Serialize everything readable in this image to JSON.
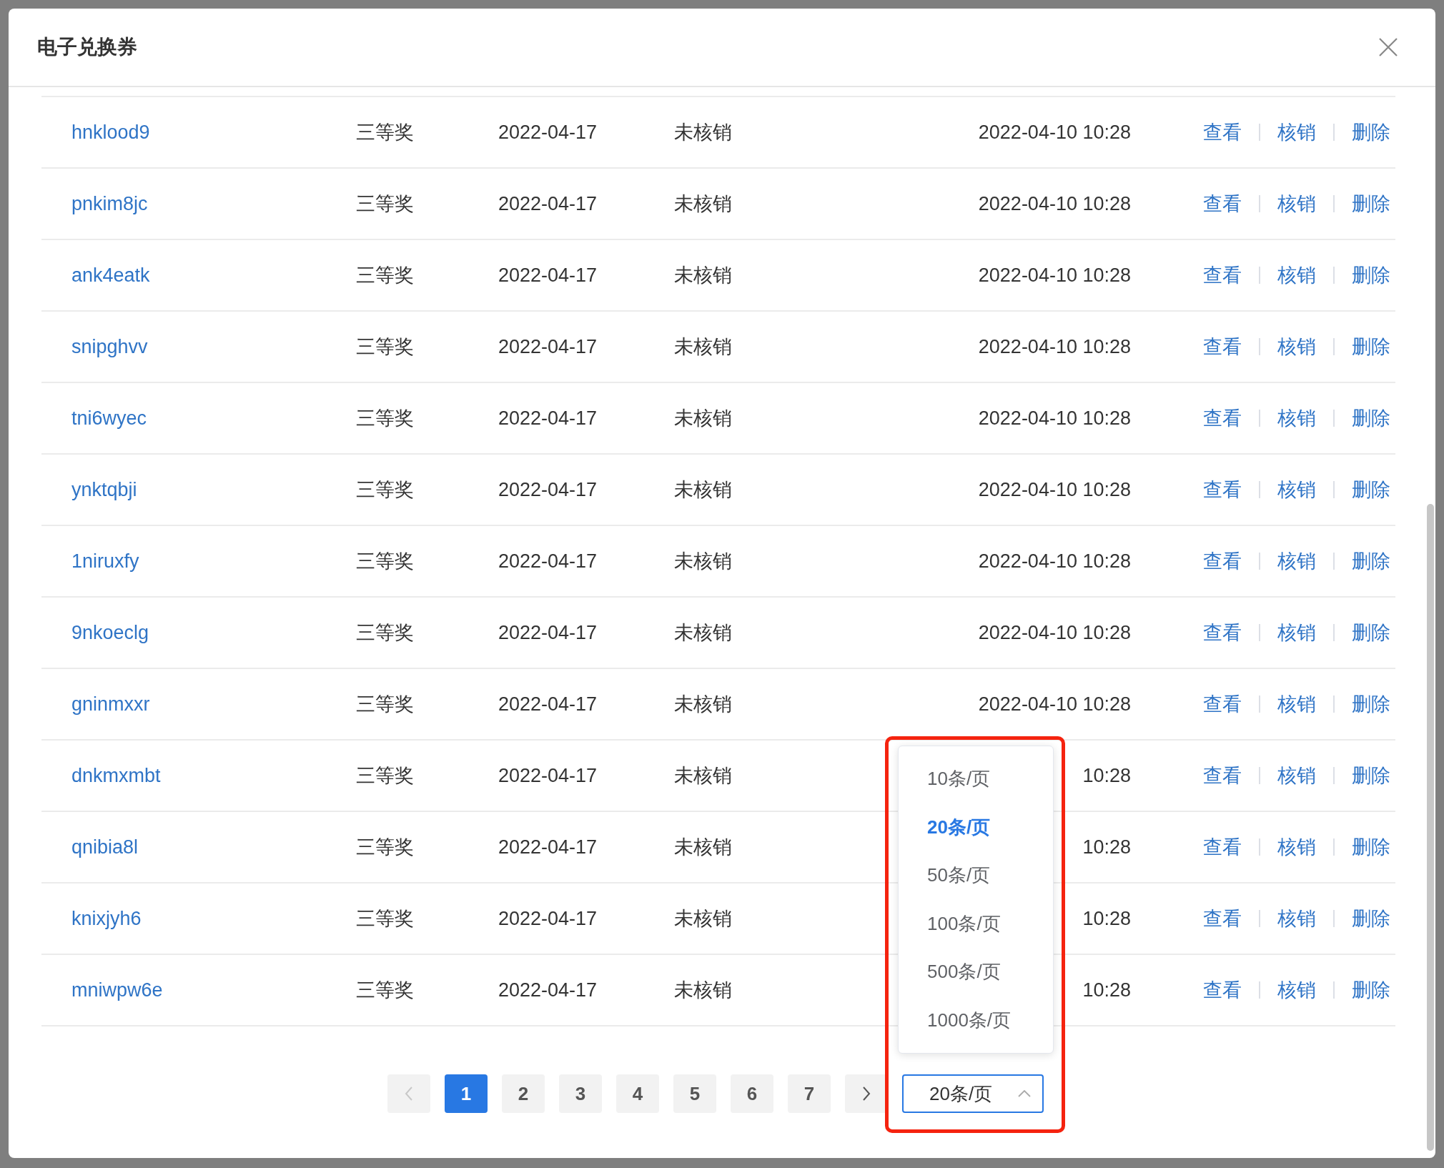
{
  "dialog": {
    "title": "电子兑换券"
  },
  "rows": [
    {
      "code": "hnklood9",
      "prize": "三等奖",
      "expiry": "2022-04-17",
      "status": "未核销",
      "created": "2022-04-10 10:28",
      "actions": [
        "查看",
        "核销",
        "删除"
      ]
    },
    {
      "code": "pnkim8jc",
      "prize": "三等奖",
      "expiry": "2022-04-17",
      "status": "未核销",
      "created": "2022-04-10 10:28",
      "actions": [
        "查看",
        "核销",
        "删除"
      ]
    },
    {
      "code": "ank4eatk",
      "prize": "三等奖",
      "expiry": "2022-04-17",
      "status": "未核销",
      "created": "2022-04-10 10:28",
      "actions": [
        "查看",
        "核销",
        "删除"
      ]
    },
    {
      "code": "snipghvv",
      "prize": "三等奖",
      "expiry": "2022-04-17",
      "status": "未核销",
      "created": "2022-04-10 10:28",
      "actions": [
        "查看",
        "核销",
        "删除"
      ]
    },
    {
      "code": "tni6wyec",
      "prize": "三等奖",
      "expiry": "2022-04-17",
      "status": "未核销",
      "created": "2022-04-10 10:28",
      "actions": [
        "查看",
        "核销",
        "删除"
      ]
    },
    {
      "code": "ynktqbji",
      "prize": "三等奖",
      "expiry": "2022-04-17",
      "status": "未核销",
      "created": "2022-04-10 10:28",
      "actions": [
        "查看",
        "核销",
        "删除"
      ]
    },
    {
      "code": "1niruxfy",
      "prize": "三等奖",
      "expiry": "2022-04-17",
      "status": "未核销",
      "created": "2022-04-10 10:28",
      "actions": [
        "查看",
        "核销",
        "删除"
      ]
    },
    {
      "code": "9nkoeclg",
      "prize": "三等奖",
      "expiry": "2022-04-17",
      "status": "未核销",
      "created": "2022-04-10 10:28",
      "actions": [
        "查看",
        "核销",
        "删除"
      ]
    },
    {
      "code": "gninmxxr",
      "prize": "三等奖",
      "expiry": "2022-04-17",
      "status": "未核销",
      "created": "2022-04-10 10:28",
      "actions": [
        "查看",
        "核销",
        "删除"
      ]
    },
    {
      "code": "dnkmxmbt",
      "prize": "三等奖",
      "expiry": "2022-04-17",
      "status": "未核销",
      "created": "10:28",
      "actions": [
        "查看",
        "核销",
        "删除"
      ]
    },
    {
      "code": "qnibia8l",
      "prize": "三等奖",
      "expiry": "2022-04-17",
      "status": "未核销",
      "created": "10:28",
      "actions": [
        "查看",
        "核销",
        "删除"
      ]
    },
    {
      "code": "knixjyh6",
      "prize": "三等奖",
      "expiry": "2022-04-17",
      "status": "未核销",
      "created": "10:28",
      "actions": [
        "查看",
        "核销",
        "删除"
      ]
    },
    {
      "code": "mniwpw6e",
      "prize": "三等奖",
      "expiry": "2022-04-17",
      "status": "未核销",
      "created": "10:28",
      "actions": [
        "查看",
        "核销",
        "删除"
      ]
    }
  ],
  "pagination": {
    "prev_disabled": true,
    "pages": [
      {
        "label": "1",
        "selected": true
      },
      {
        "label": "2",
        "selected": false
      },
      {
        "label": "3",
        "selected": false
      },
      {
        "label": "4",
        "selected": false
      },
      {
        "label": "5",
        "selected": false
      },
      {
        "label": "6",
        "selected": false
      },
      {
        "label": "7",
        "selected": false
      }
    ],
    "page_size": "20条/页",
    "expanded": true,
    "page_size_options": [
      {
        "label": "10条/页",
        "selected": false
      },
      {
        "label": "20条/页",
        "selected": true
      },
      {
        "label": "50条/页",
        "selected": false
      },
      {
        "label": "100条/页",
        "selected": false
      },
      {
        "label": "500条/页",
        "selected": false
      },
      {
        "label": "1000条/页",
        "selected": false
      }
    ]
  },
  "highlight_frame": true
}
